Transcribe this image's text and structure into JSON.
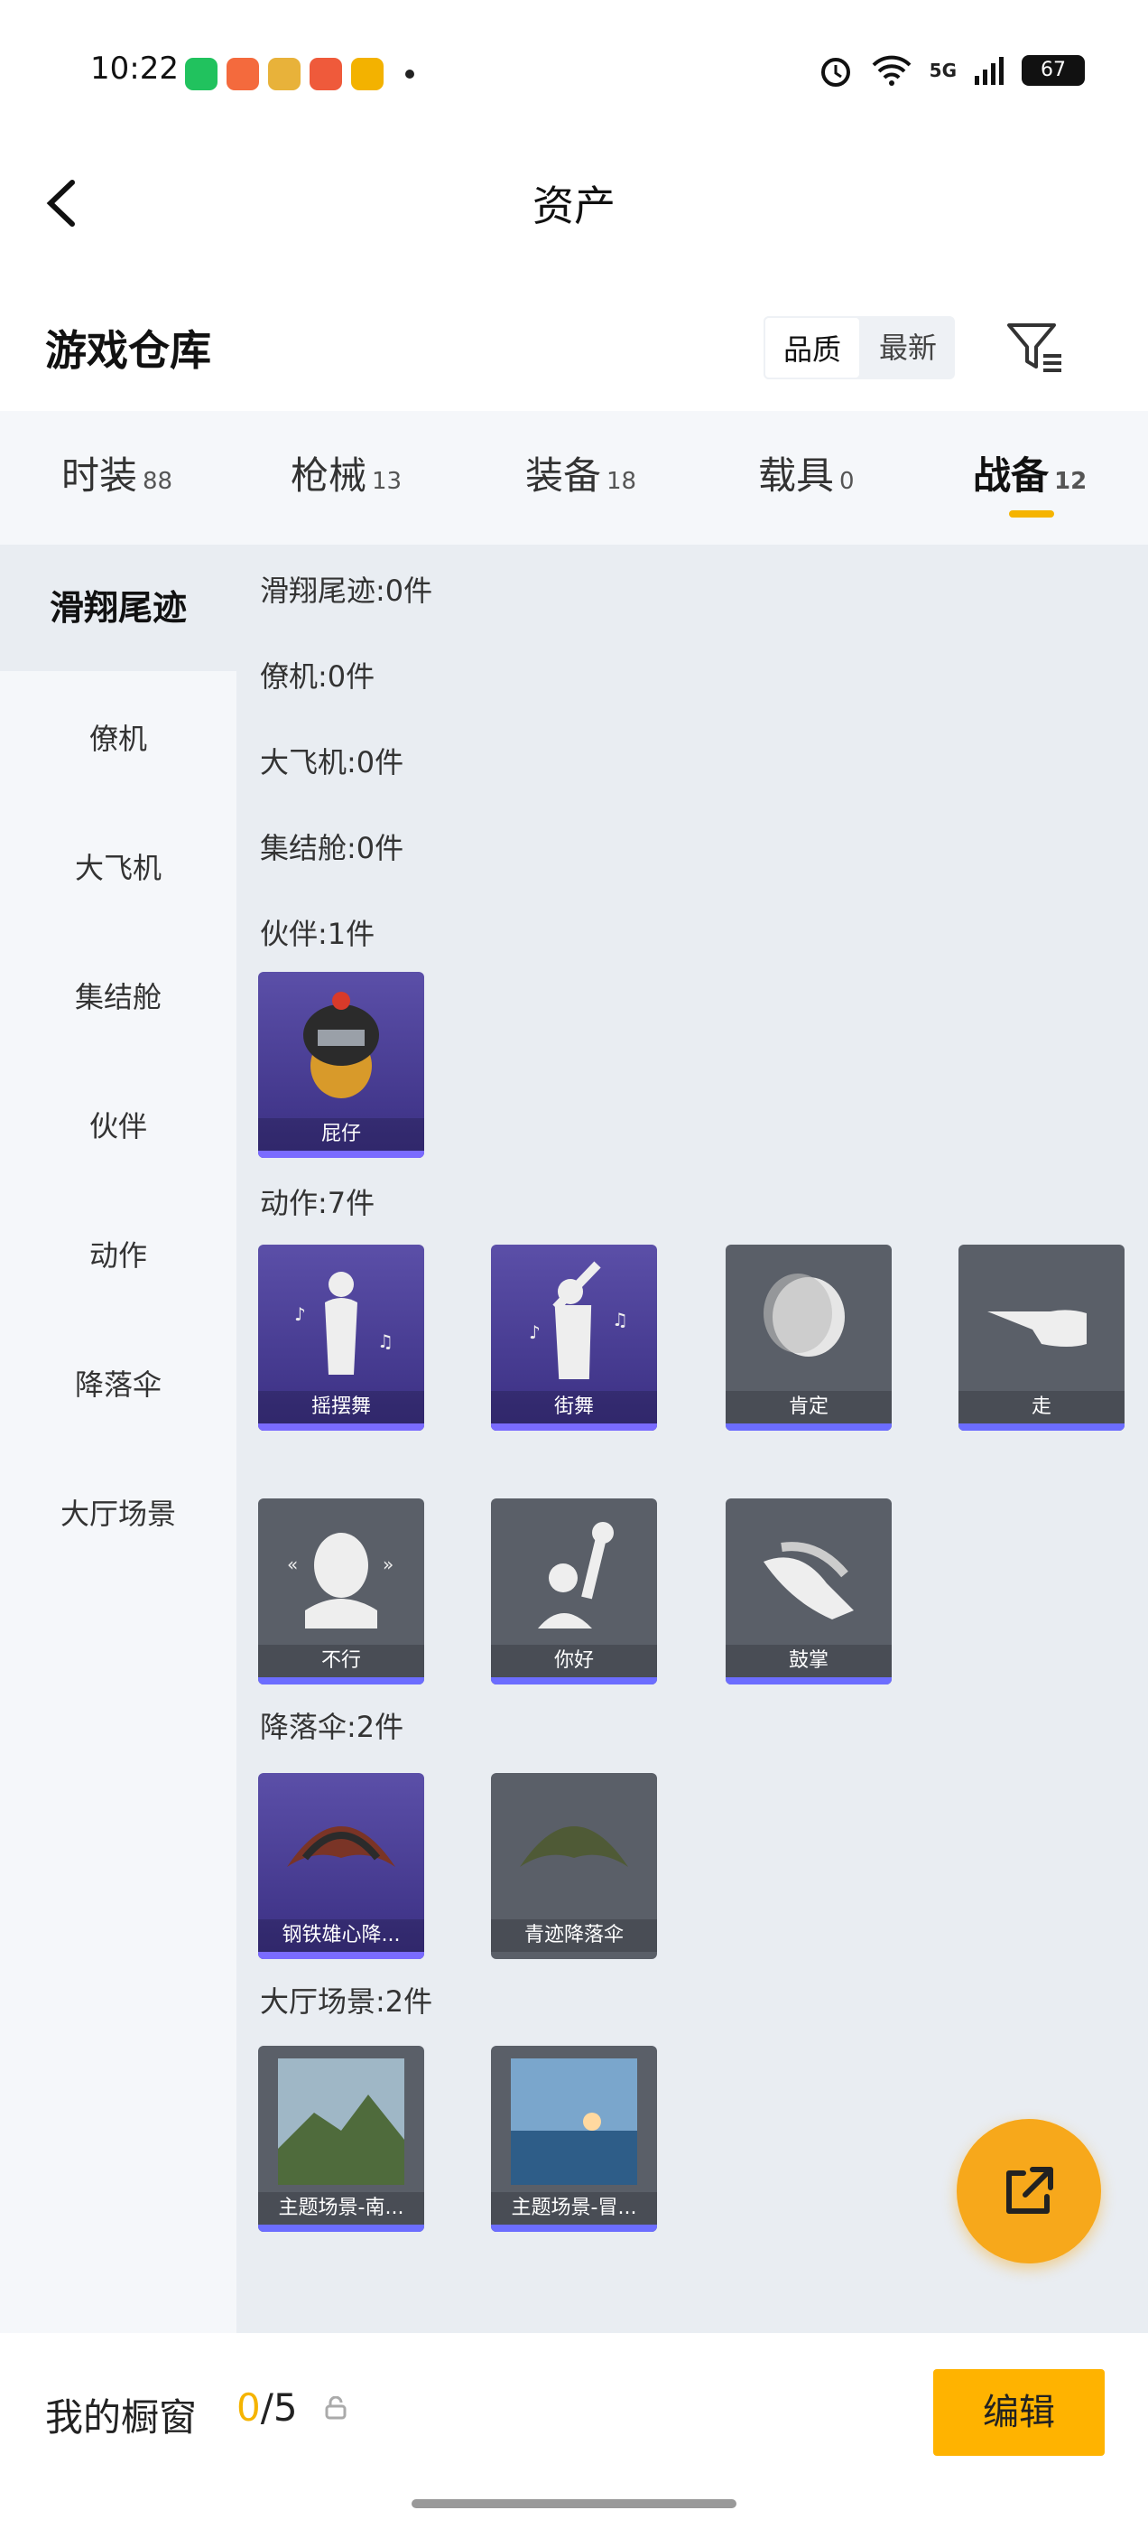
{
  "status": {
    "time": "10:22",
    "network": "5G",
    "battery": "67"
  },
  "header": {
    "title": "资产",
    "back_icon": "chevron-left-icon"
  },
  "warehouse": {
    "title": "游戏仓库",
    "sort_options": [
      "品质",
      "最新"
    ],
    "active_sort": 0,
    "filter_icon": "filter-icon"
  },
  "tabs": [
    {
      "label": "时装",
      "count": "88"
    },
    {
      "label": "枪械",
      "count": "13"
    },
    {
      "label": "装备",
      "count": "18"
    },
    {
      "label": "载具",
      "count": "0"
    },
    {
      "label": "战备",
      "count": "12"
    }
  ],
  "active_tab": 4,
  "sidebar": {
    "items": [
      "滑翔尾迹",
      "僚机",
      "大飞机",
      "集结舱",
      "伙伴",
      "动作",
      "降落伞",
      "大厅场景"
    ],
    "active": 0
  },
  "sections": [
    {
      "title": "滑翔尾迹:0件"
    },
    {
      "title": "僚机:0件"
    },
    {
      "title": "大飞机:0件"
    },
    {
      "title": "集结舱:0件"
    },
    {
      "title": "伙伴:1件",
      "items": [
        "屁仔"
      ]
    },
    {
      "title": "动作:7件",
      "items": [
        "摇摆舞",
        "街舞",
        "肯定",
        "走",
        "不行",
        "你好",
        "鼓掌"
      ]
    },
    {
      "title": "降落伞:2件",
      "items": [
        "钢铁雄心降...",
        "青迹降落伞"
      ]
    },
    {
      "title": "大厅场景:2件",
      "items": [
        "主题场景-南...",
        "主题场景-冒..."
      ]
    }
  ],
  "footer": {
    "label": "我的橱窗",
    "current": "0",
    "total": "/5",
    "edit_label": "编辑"
  },
  "colors": {
    "accent": "#f5b400",
    "fab": "#f7a81b",
    "purple_card": "#4a3f98",
    "grey_card": "#5a5f68"
  }
}
